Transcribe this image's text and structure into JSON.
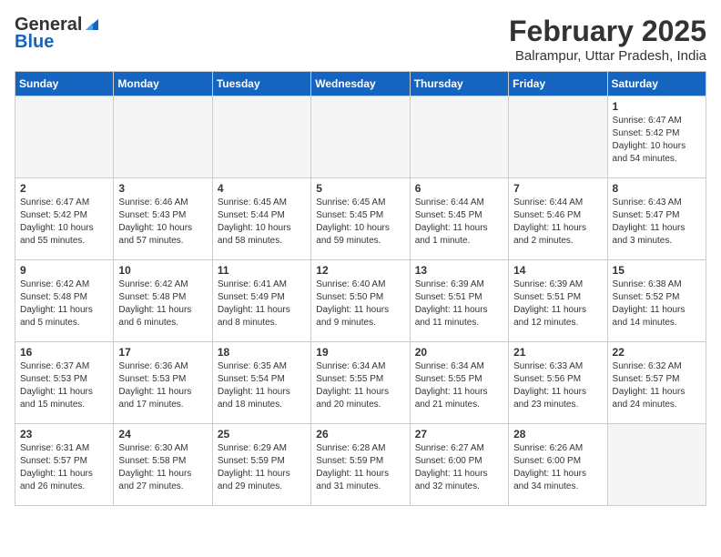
{
  "header": {
    "logo_general": "General",
    "logo_blue": "Blue",
    "month_title": "February 2025",
    "subtitle": "Balrampur, Uttar Pradesh, India"
  },
  "weekdays": [
    "Sunday",
    "Monday",
    "Tuesday",
    "Wednesday",
    "Thursday",
    "Friday",
    "Saturday"
  ],
  "weeks": [
    [
      {
        "day": "",
        "info": ""
      },
      {
        "day": "",
        "info": ""
      },
      {
        "day": "",
        "info": ""
      },
      {
        "day": "",
        "info": ""
      },
      {
        "day": "",
        "info": ""
      },
      {
        "day": "",
        "info": ""
      },
      {
        "day": "1",
        "info": "Sunrise: 6:47 AM\nSunset: 5:42 PM\nDaylight: 10 hours\nand 54 minutes."
      }
    ],
    [
      {
        "day": "2",
        "info": "Sunrise: 6:47 AM\nSunset: 5:42 PM\nDaylight: 10 hours\nand 55 minutes."
      },
      {
        "day": "3",
        "info": "Sunrise: 6:46 AM\nSunset: 5:43 PM\nDaylight: 10 hours\nand 57 minutes."
      },
      {
        "day": "4",
        "info": "Sunrise: 6:45 AM\nSunset: 5:44 PM\nDaylight: 10 hours\nand 58 minutes."
      },
      {
        "day": "5",
        "info": "Sunrise: 6:45 AM\nSunset: 5:45 PM\nDaylight: 10 hours\nand 59 minutes."
      },
      {
        "day": "6",
        "info": "Sunrise: 6:44 AM\nSunset: 5:45 PM\nDaylight: 11 hours\nand 1 minute."
      },
      {
        "day": "7",
        "info": "Sunrise: 6:44 AM\nSunset: 5:46 PM\nDaylight: 11 hours\nand 2 minutes."
      },
      {
        "day": "8",
        "info": "Sunrise: 6:43 AM\nSunset: 5:47 PM\nDaylight: 11 hours\nand 3 minutes."
      }
    ],
    [
      {
        "day": "9",
        "info": "Sunrise: 6:42 AM\nSunset: 5:48 PM\nDaylight: 11 hours\nand 5 minutes."
      },
      {
        "day": "10",
        "info": "Sunrise: 6:42 AM\nSunset: 5:48 PM\nDaylight: 11 hours\nand 6 minutes."
      },
      {
        "day": "11",
        "info": "Sunrise: 6:41 AM\nSunset: 5:49 PM\nDaylight: 11 hours\nand 8 minutes."
      },
      {
        "day": "12",
        "info": "Sunrise: 6:40 AM\nSunset: 5:50 PM\nDaylight: 11 hours\nand 9 minutes."
      },
      {
        "day": "13",
        "info": "Sunrise: 6:39 AM\nSunset: 5:51 PM\nDaylight: 11 hours\nand 11 minutes."
      },
      {
        "day": "14",
        "info": "Sunrise: 6:39 AM\nSunset: 5:51 PM\nDaylight: 11 hours\nand 12 minutes."
      },
      {
        "day": "15",
        "info": "Sunrise: 6:38 AM\nSunset: 5:52 PM\nDaylight: 11 hours\nand 14 minutes."
      }
    ],
    [
      {
        "day": "16",
        "info": "Sunrise: 6:37 AM\nSunset: 5:53 PM\nDaylight: 11 hours\nand 15 minutes."
      },
      {
        "day": "17",
        "info": "Sunrise: 6:36 AM\nSunset: 5:53 PM\nDaylight: 11 hours\nand 17 minutes."
      },
      {
        "day": "18",
        "info": "Sunrise: 6:35 AM\nSunset: 5:54 PM\nDaylight: 11 hours\nand 18 minutes."
      },
      {
        "day": "19",
        "info": "Sunrise: 6:34 AM\nSunset: 5:55 PM\nDaylight: 11 hours\nand 20 minutes."
      },
      {
        "day": "20",
        "info": "Sunrise: 6:34 AM\nSunset: 5:55 PM\nDaylight: 11 hours\nand 21 minutes."
      },
      {
        "day": "21",
        "info": "Sunrise: 6:33 AM\nSunset: 5:56 PM\nDaylight: 11 hours\nand 23 minutes."
      },
      {
        "day": "22",
        "info": "Sunrise: 6:32 AM\nSunset: 5:57 PM\nDaylight: 11 hours\nand 24 minutes."
      }
    ],
    [
      {
        "day": "23",
        "info": "Sunrise: 6:31 AM\nSunset: 5:57 PM\nDaylight: 11 hours\nand 26 minutes."
      },
      {
        "day": "24",
        "info": "Sunrise: 6:30 AM\nSunset: 5:58 PM\nDaylight: 11 hours\nand 27 minutes."
      },
      {
        "day": "25",
        "info": "Sunrise: 6:29 AM\nSunset: 5:59 PM\nDaylight: 11 hours\nand 29 minutes."
      },
      {
        "day": "26",
        "info": "Sunrise: 6:28 AM\nSunset: 5:59 PM\nDaylight: 11 hours\nand 31 minutes."
      },
      {
        "day": "27",
        "info": "Sunrise: 6:27 AM\nSunset: 6:00 PM\nDaylight: 11 hours\nand 32 minutes."
      },
      {
        "day": "28",
        "info": "Sunrise: 6:26 AM\nSunset: 6:00 PM\nDaylight: 11 hours\nand 34 minutes."
      },
      {
        "day": "",
        "info": ""
      }
    ]
  ]
}
